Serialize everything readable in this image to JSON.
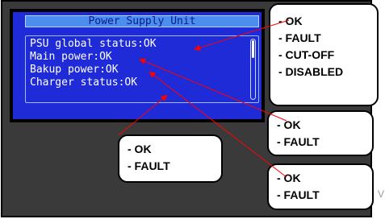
{
  "lcd": {
    "title": "Power Supply Unit",
    "lines": [
      "PSU global status:OK",
      "Main power:OK",
      "Bakup power:OK",
      "Charger status:OK"
    ]
  },
  "callouts": {
    "psu_global": [
      "- OK",
      "- FAULT",
      "- CUT-OFF",
      "- DISABLED"
    ],
    "main_power": [
      "- OK",
      "- FAULT"
    ],
    "bakup_power": [
      "- OK",
      "- FAULT"
    ],
    "charger": [
      "- OK",
      "- FAULT"
    ]
  },
  "colors": {
    "lcd_background": "#1f2bd6",
    "title_bar": "#4a8ef0",
    "arrow": "#ff0000"
  },
  "edge_text": "V"
}
